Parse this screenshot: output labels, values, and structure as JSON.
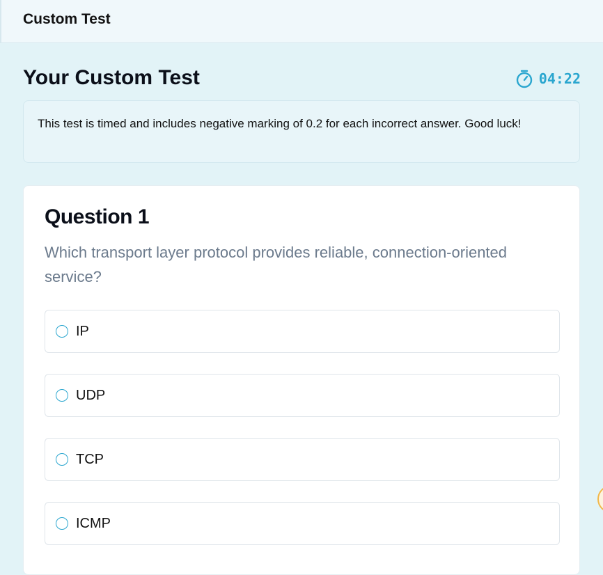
{
  "topbar": {
    "title": "Custom Test"
  },
  "header": {
    "title": "Your Custom Test",
    "timer_icon": "stopwatch-icon",
    "timer_value": "04:22",
    "accent_color": "#2aa6cf"
  },
  "notice": {
    "text": "This test is timed and includes negative marking of 0.2 for each incorrect answer. Good luck!"
  },
  "question": {
    "title": "Question 1",
    "text": "Which transport layer protocol provides reliable, connection-oriented service?",
    "options": [
      {
        "label": "IP"
      },
      {
        "label": "UDP"
      },
      {
        "label": "TCP"
      },
      {
        "label": "ICMP"
      }
    ]
  }
}
